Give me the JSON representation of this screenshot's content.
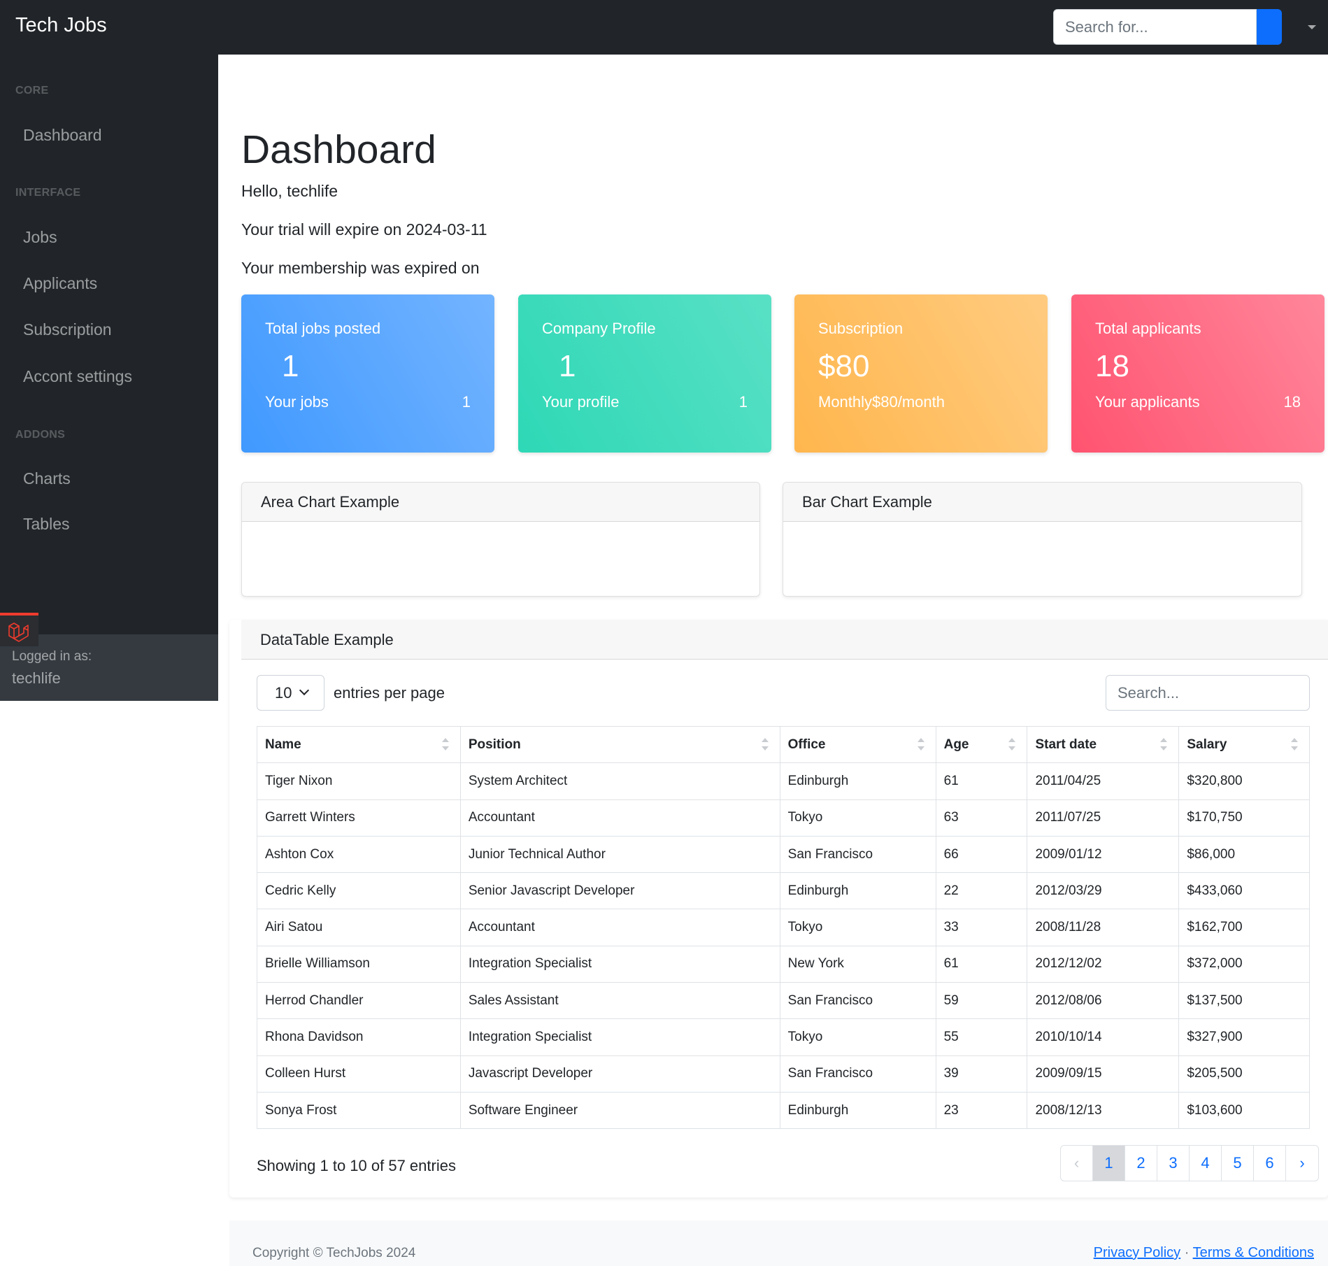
{
  "navbar": {
    "brand": "Tech Jobs",
    "search_placeholder": "Search for..."
  },
  "sidebar": {
    "sections": [
      {
        "heading": "CORE",
        "items": [
          "Dashboard"
        ]
      },
      {
        "heading": "INTERFACE",
        "items": [
          "Jobs",
          "Applicants",
          "Subscription",
          "Accont settings"
        ]
      },
      {
        "heading": "ADDONS",
        "items": [
          "Charts",
          "Tables"
        ]
      }
    ],
    "footer_label": "Logged in as:",
    "footer_user": "techlife"
  },
  "main": {
    "title": "Dashboard",
    "greeting": "Hello, techlife",
    "trial": "Your trial will expire on 2024-03-11",
    "membership": "Your membership was expired on"
  },
  "cards": [
    {
      "title": "Total jobs posted",
      "value": "1",
      "footer": "Your jobs",
      "count": "1",
      "color": "#4099ff"
    },
    {
      "title": "Company Profile",
      "value": "1",
      "footer": "Your profile",
      "count": "1",
      "color": "#2ed8b6"
    },
    {
      "title": "Subscription",
      "value": "$80",
      "footer": "Monthly$80/month",
      "count": "",
      "color": "#ffb64d"
    },
    {
      "title": "Total applicants",
      "value": "18",
      "footer": "Your applicants",
      "count": "18",
      "color": "#ff5370"
    }
  ],
  "charts": {
    "area_title": "Area Chart Example",
    "bar_title": "Bar Chart Example"
  },
  "datatable": {
    "title": "DataTable Example",
    "per_page": "10",
    "per_page_label": "entries per page",
    "search_placeholder": "Search...",
    "columns": [
      "Name",
      "Position",
      "Office",
      "Age",
      "Start date",
      "Salary"
    ],
    "rows": [
      [
        "Tiger Nixon",
        "System Architect",
        "Edinburgh",
        "61",
        "2011/04/25",
        "$320,800"
      ],
      [
        "Garrett Winters",
        "Accountant",
        "Tokyo",
        "63",
        "2011/07/25",
        "$170,750"
      ],
      [
        "Ashton Cox",
        "Junior Technical Author",
        "San Francisco",
        "66",
        "2009/01/12",
        "$86,000"
      ],
      [
        "Cedric Kelly",
        "Senior Javascript Developer",
        "Edinburgh",
        "22",
        "2012/03/29",
        "$433,060"
      ],
      [
        "Airi Satou",
        "Accountant",
        "Tokyo",
        "33",
        "2008/11/28",
        "$162,700"
      ],
      [
        "Brielle Williamson",
        "Integration Specialist",
        "New York",
        "61",
        "2012/12/02",
        "$372,000"
      ],
      [
        "Herrod Chandler",
        "Sales Assistant",
        "San Francisco",
        "59",
        "2012/08/06",
        "$137,500"
      ],
      [
        "Rhona Davidson",
        "Integration Specialist",
        "Tokyo",
        "55",
        "2010/10/14",
        "$327,900"
      ],
      [
        "Colleen Hurst",
        "Javascript Developer",
        "San Francisco",
        "39",
        "2009/09/15",
        "$205,500"
      ],
      [
        "Sonya Frost",
        "Software Engineer",
        "Edinburgh",
        "23",
        "2008/12/13",
        "$103,600"
      ]
    ],
    "showing": "Showing 1 to 10 of 57 entries",
    "pagination": {
      "prev": "‹",
      "pages": [
        "1",
        "2",
        "3",
        "4",
        "5",
        "6"
      ],
      "next": "›",
      "current": "1"
    }
  },
  "footer": {
    "copyright": "Copyright © TechJobs 2024",
    "privacy": "Privacy Policy",
    "separator": "·",
    "terms": "Terms & Conditions"
  }
}
